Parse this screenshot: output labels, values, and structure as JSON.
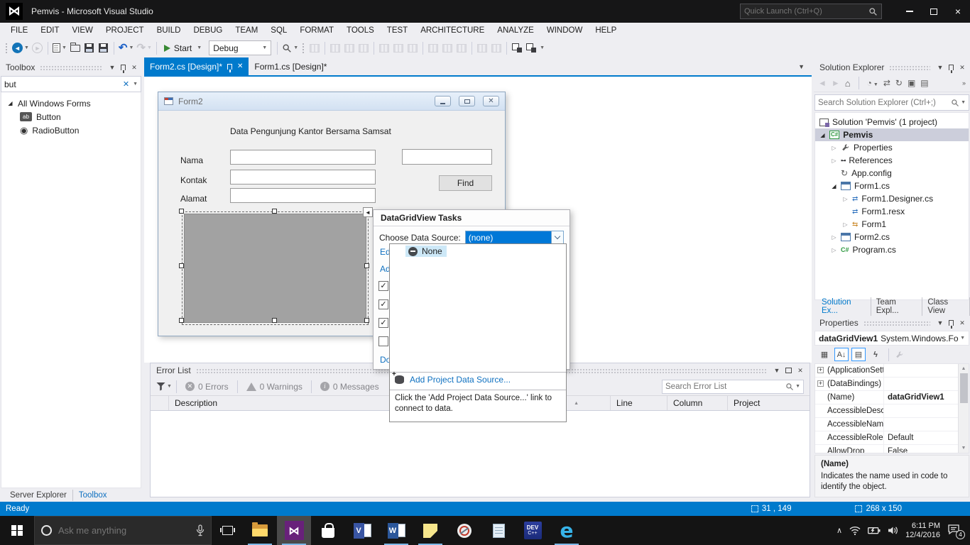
{
  "title_bar": {
    "title": "Pemvis - Microsoft Visual Studio",
    "quick_launch_placeholder": "Quick Launch (Ctrl+Q)"
  },
  "menubar": {
    "items": [
      "FILE",
      "EDIT",
      "VIEW",
      "PROJECT",
      "BUILD",
      "DEBUG",
      "TEAM",
      "SQL",
      "FORMAT",
      "TOOLS",
      "TEST",
      "ARCHITECTURE",
      "ANALYZE",
      "WINDOW",
      "HELP"
    ]
  },
  "toolbar": {
    "start_label": "Start",
    "configuration": "Debug"
  },
  "toolbox": {
    "title": "Toolbox",
    "search_value": "but",
    "group_label": "All Windows Forms",
    "items": [
      "Button",
      "RadioButton"
    ],
    "bottom_tabs": [
      "Server Explorer",
      "Toolbox"
    ]
  },
  "editor": {
    "tabs": [
      {
        "label": "Form2.cs [Design]*"
      },
      {
        "label": "Form1.cs [Design]*"
      }
    ]
  },
  "form_designer": {
    "window_title": "Form2",
    "heading": "Data Pengunjung Kantor Bersama Samsat",
    "labels": [
      "Nama",
      "Kontak",
      "Alamat"
    ],
    "find_button": "Find"
  },
  "smart_panel": {
    "title": "DataGridView Tasks",
    "choose_label": "Choose Data Source:",
    "combo_value": "(none)",
    "edit_link_fragment": "Edit",
    "add_link_fragment": "Add",
    "dock_link_fragment": "Doc"
  },
  "datasource_dropdown": {
    "none_label": "None",
    "add_link": "Add Project Data Source...",
    "help_text": "Click the 'Add Project Data Source...' link to connect to data."
  },
  "error_list": {
    "title": "Error List",
    "errors": "0 Errors",
    "warnings": "0 Warnings",
    "messages": "0 Messages",
    "search_placeholder": "Search Error List",
    "columns": [
      "Description",
      "Line",
      "Column",
      "Project"
    ]
  },
  "solution_explorer": {
    "title": "Solution Explorer",
    "search_placeholder": "Search Solution Explorer (Ctrl+;)",
    "items": [
      {
        "label": "Solution 'Pemvis' (1 project)"
      },
      {
        "label": "Pemvis"
      },
      {
        "label": "Properties"
      },
      {
        "label": "References"
      },
      {
        "label": "App.config"
      },
      {
        "label": "Form1.cs"
      },
      {
        "label": "Form1.Designer.cs"
      },
      {
        "label": "Form1.resx"
      },
      {
        "label": "Form1"
      },
      {
        "label": "Form2.cs"
      },
      {
        "label": "Program.cs"
      }
    ]
  },
  "panel_tabs": [
    "Solution Ex...",
    "Team Expl...",
    "Class View"
  ],
  "properties": {
    "title": "Properties",
    "object_name": "dataGridView1",
    "object_type": "System.Windows.For",
    "rows": [
      {
        "name": "(ApplicationSett",
        "value": ""
      },
      {
        "name": "(DataBindings)",
        "value": ""
      },
      {
        "name": "(Name)",
        "value": "dataGridView1"
      },
      {
        "name": "AccessibleDescr",
        "value": ""
      },
      {
        "name": "AccessibleName",
        "value": ""
      },
      {
        "name": "AccessibleRole",
        "value": "Default"
      },
      {
        "name": "AllowDrop",
        "value": "False"
      }
    ],
    "description_title": "(Name)",
    "description_text": "Indicates the name used in code to identify the object."
  },
  "status_bar": {
    "state": "Ready",
    "position": "31 , 149",
    "size": "268 x 150"
  },
  "taskbar": {
    "search_placeholder": "Ask me anything",
    "time": "6:11 PM",
    "date": "12/4/2016",
    "notification_count": "4",
    "icons": [
      "file-explorer",
      "visual-studio",
      "store",
      "visio",
      "word",
      "sticky-notes",
      "snipping-tool",
      "notepad",
      "dev-cpp",
      "edge"
    ]
  }
}
